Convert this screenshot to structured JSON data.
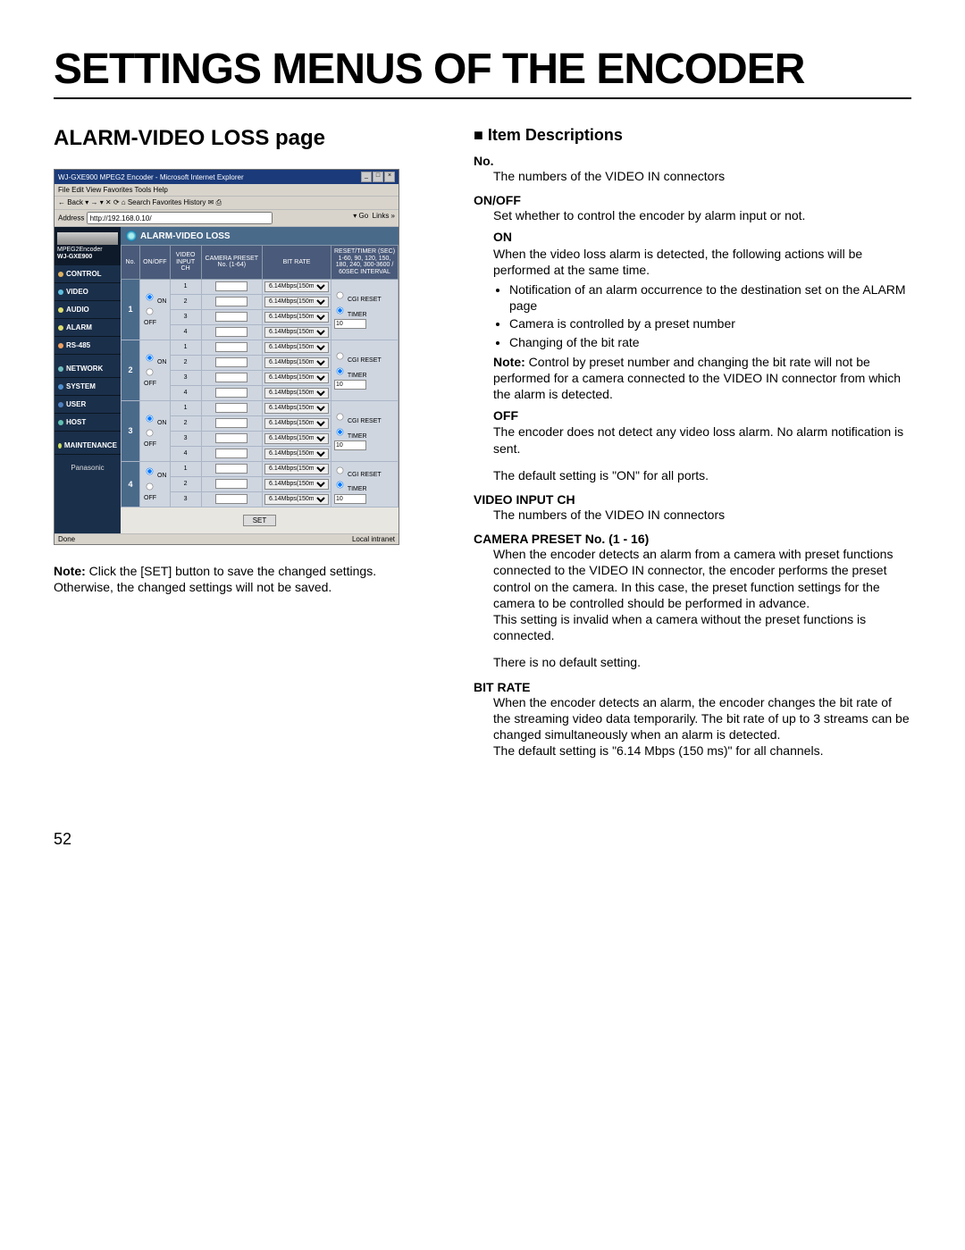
{
  "page": {
    "title": "SETTINGS MENUS OF THE ENCODER",
    "section_title": "ALARM-VIDEO LOSS page",
    "number": "52"
  },
  "note_under_screenshot": {
    "label": "Note:",
    "text": "Click the [SET] button to save the changed settings. Otherwise, the changed settings will not be saved."
  },
  "screenshot": {
    "window_title": "WJ-GXE900 MPEG2 Encoder - Microsoft Internet Explorer",
    "menubar": "File   Edit   View   Favorites   Tools   Help",
    "toolbar": "← Back  ▾  →  ▾  ✕  ⟳  ⌂   Search   Favorites   History   ✉  ⎙",
    "address_label": "Address",
    "address_value": "http://192.168.0.10/",
    "go_label": "Go",
    "links_label": "Links",
    "logo_line1": "MPEG2Encoder",
    "logo_line2": "WJ-GXE900",
    "nav": [
      {
        "label": "CONTROL",
        "color": "#e0b060"
      },
      {
        "label": "VIDEO",
        "color": "#60c0e0"
      },
      {
        "label": "AUDIO",
        "color": "#e0e070"
      },
      {
        "label": "ALARM",
        "color": "#e0e070"
      },
      {
        "label": "RS-485",
        "color": "#f0a060"
      },
      {
        "label": "NETWORK",
        "color": "#70c0c0"
      },
      {
        "label": "SYSTEM",
        "color": "#5090d0"
      },
      {
        "label": "USER",
        "color": "#5080c0"
      },
      {
        "label": "HOST",
        "color": "#60c0b0"
      },
      {
        "label": "MAINTENANCE",
        "color": "#d0e060"
      }
    ],
    "brand": "Panasonic",
    "page_title": "ALARM-VIDEO LOSS",
    "headers": {
      "no": "No.",
      "onoff": "ON/OFF",
      "vich": "VIDEO INPUT CH",
      "preset": "CAMERA PRESET No. (1-64)",
      "bitrate": "BIT RATE",
      "reset": "RESET/TIMER (SEC) 1-60, 90, 120, 150, 180, 240, 300-3600 / 60SEC INTERVAL"
    },
    "onoff_on": "ON",
    "onoff_off": "OFF",
    "bitrate_value": "6.14Mbps(150ms)",
    "reset_cgi": "CGI RESET",
    "reset_timer": "TIMER",
    "reset_timer_value": "10",
    "groups": [
      "1",
      "2",
      "3",
      "4"
    ],
    "channels_per_group": [
      "1",
      "2",
      "3",
      "4"
    ],
    "three_channels": [
      "1",
      "2",
      "3"
    ],
    "set_label": "SET",
    "status_left": "Done",
    "status_right": "Local intranet"
  },
  "right": {
    "header": "■ Item Descriptions",
    "items": [
      {
        "label": "No.",
        "body": "The numbers of the VIDEO IN connectors"
      }
    ],
    "onoff": {
      "label": "ON/OFF",
      "intro": "Set whether to control the encoder by alarm input or not.",
      "on_label": "ON",
      "on_text": "When the video loss alarm is detected, the following actions will be performed at the same time.",
      "bullets": [
        "Notification of an alarm occurrence to the destination set on the ALARM page",
        "Camera is controlled by a preset number",
        "Changing of the bit rate"
      ],
      "note_label": "Note:",
      "note_text": "Control by preset number and changing the bit rate will not be performed for a camera connected to the VIDEO IN connector from which the alarm is detected.",
      "off_label": "OFF",
      "off_text": "The encoder does not detect any video loss alarm. No alarm notification is sent.",
      "default": "The default setting is \"ON\" for all ports."
    },
    "vich": {
      "label": "VIDEO INPUT CH",
      "body": "The numbers of the VIDEO IN connectors"
    },
    "preset": {
      "label": "CAMERA PRESET No. (1 - 16)",
      "p1": "When the encoder detects an alarm from a camera with preset functions connected to the VIDEO IN connector, the encoder performs the preset control on the camera. In this case, the preset function settings for the camera to be controlled should be performed in advance.",
      "p2": "This setting is invalid when a camera without the preset functions is connected.",
      "p3": "There is no default setting."
    },
    "bitrate": {
      "label": "BIT RATE",
      "p1": "When the encoder detects an alarm, the encoder changes the bit rate of the streaming video data temporarily. The bit rate of up to 3 streams can be changed simultaneously when an alarm is detected.",
      "p2": "The default setting is \"6.14 Mbps (150 ms)\" for all channels."
    }
  }
}
